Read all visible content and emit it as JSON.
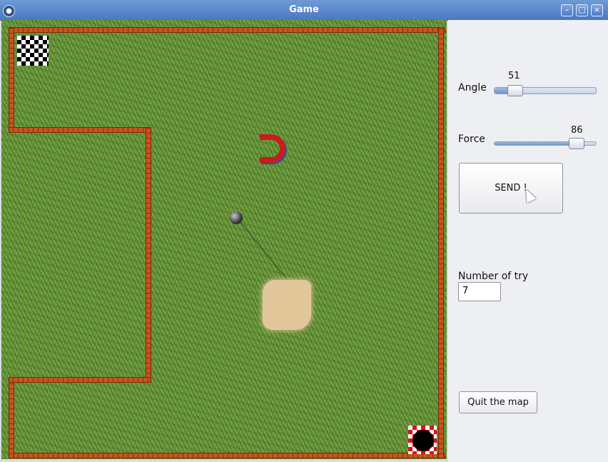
{
  "window": {
    "title": "Game"
  },
  "controls": {
    "angle": {
      "label": "Angle",
      "value": 51,
      "fraction": 0.2
    },
    "force": {
      "label": "Force",
      "value": 86,
      "fraction": 0.8
    },
    "send_label": "SEND !",
    "tries_label": "Number of try",
    "tries_value": "7",
    "quit_label": "Quit the map"
  },
  "game": {
    "obstacles": [
      "magnet",
      "sand-trap"
    ],
    "start": "checkered-flag",
    "goal": "hole"
  }
}
